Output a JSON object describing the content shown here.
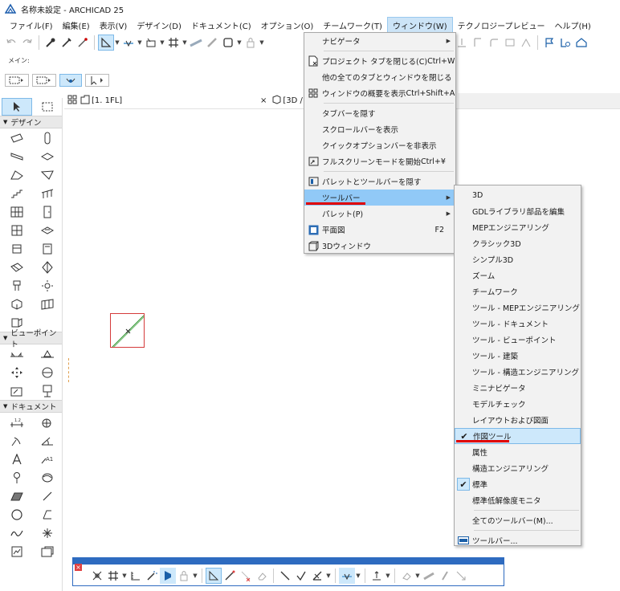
{
  "window": {
    "title": "名称未設定 - ARCHICAD 25"
  },
  "menubar": [
    {
      "label": "ファイル(F)"
    },
    {
      "label": "編集(E)"
    },
    {
      "label": "表示(V)"
    },
    {
      "label": "デザイン(D)"
    },
    {
      "label": "ドキュメント(C)"
    },
    {
      "label": "オプション(O)"
    },
    {
      "label": "チームワーク(T)"
    },
    {
      "label": "ウィンドウ(W)"
    },
    {
      "label": "テクノロジープレビュー"
    },
    {
      "label": "ヘルプ(H)"
    }
  ],
  "info_label": "メイン:",
  "toolbox": {
    "design_header": "デザイン",
    "viewpoint_header": "ビューポイント",
    "document_header": "ドキュメント"
  },
  "tabs": {
    "plan": "[1. 1FL]",
    "view3d": "[3D /"
  },
  "window_menu": {
    "items": [
      {
        "label": "ナビゲータ",
        "shortcut": "",
        "submenu": true
      },
      {
        "label": "プロジェクト タブを閉じる(C)",
        "shortcut": "Ctrl+W"
      },
      {
        "label": "他の全てのタブとウィンドウを閉じる",
        "shortcut": ""
      },
      {
        "label": "ウィンドウの概要を表示",
        "shortcut": "Ctrl+Shift+A"
      },
      {
        "label": "タブバーを隠す",
        "shortcut": ""
      },
      {
        "label": "スクロールバーを表示",
        "shortcut": ""
      },
      {
        "label": "クイックオプションバーを非表示",
        "shortcut": ""
      },
      {
        "label": "フルスクリーンモードを開始",
        "shortcut": "Ctrl+¥"
      },
      {
        "label": "パレットとツールバーを隠す",
        "shortcut": ""
      },
      {
        "label": "ツールバー",
        "shortcut": "",
        "submenu": true
      },
      {
        "label": "パレット(P)",
        "shortcut": "",
        "submenu": true
      },
      {
        "label": "平面図",
        "shortcut": "F2"
      },
      {
        "label": "3Dウィンドウ",
        "shortcut": ""
      }
    ]
  },
  "toolbar_submenu": {
    "items": [
      {
        "label": "3D",
        "checked": false
      },
      {
        "label": "GDLライブラリ部品を編集",
        "checked": false
      },
      {
        "label": "MEPエンジニアリング",
        "checked": false
      },
      {
        "label": "クラシック3D",
        "checked": false
      },
      {
        "label": "シンプル3D",
        "checked": false
      },
      {
        "label": "ズーム",
        "checked": false
      },
      {
        "label": "チームワーク",
        "checked": false
      },
      {
        "label": "ツール - MEPエンジニアリング",
        "checked": false
      },
      {
        "label": "ツール - ドキュメント",
        "checked": false
      },
      {
        "label": "ツール - ビューポイント",
        "checked": false
      },
      {
        "label": "ツール - 建築",
        "checked": false
      },
      {
        "label": "ツール - 構造エンジニアリング",
        "checked": false
      },
      {
        "label": "ミニナビゲータ",
        "checked": false
      },
      {
        "label": "モデルチェック",
        "checked": false
      },
      {
        "label": "レイアウトおよび図面",
        "checked": false
      },
      {
        "label": "作図ツール",
        "checked": true
      },
      {
        "label": "属性",
        "checked": false
      },
      {
        "label": "構造エンジニアリング",
        "checked": false
      },
      {
        "label": "標準",
        "checked": true
      },
      {
        "label": "標準低解像度モニタ",
        "checked": false
      },
      {
        "label": "全てのツールバー(M)...",
        "checked": false
      },
      {
        "label": "ツールバー...",
        "checked": false
      }
    ]
  },
  "colors": {
    "highlight": "#91c9f7",
    "accent_red": "#e00000",
    "floatbar_blue": "#2e6bc0"
  }
}
